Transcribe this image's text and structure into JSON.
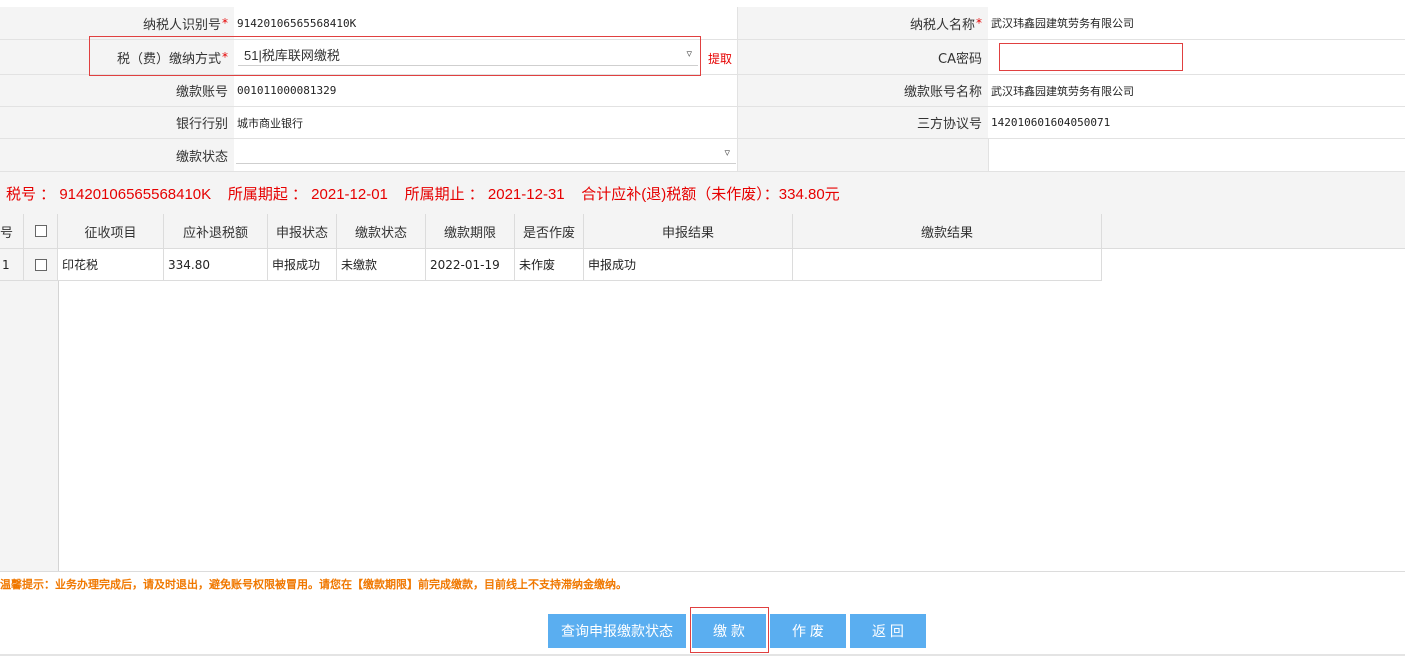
{
  "form": {
    "taxpayer_id_label": "纳税人识别号",
    "taxpayer_id_value": "91420106565568410K",
    "taxpayer_name_label": "纳税人名称",
    "taxpayer_name_value": "武汉玮鑫园建筑劳务有限公司",
    "payment_method_label": "税（费）缴纳方式",
    "payment_method_value": "51|税库联网缴税",
    "fetch_link": "提取",
    "ca_password_label": "CA密码",
    "ca_password_value": "",
    "account_no_label": "缴款账号",
    "account_no_value": "001011000081329",
    "account_name_label": "缴款账号名称",
    "account_name_value": "武汉玮鑫园建筑劳务有限公司",
    "bank_label": "银行行别",
    "bank_value": "城市商业银行",
    "agreement_label": "三方协议号",
    "agreement_value": "142010601604050071",
    "payment_status_label": "缴款状态",
    "payment_status_value": "",
    "required_mark": "*"
  },
  "summary": {
    "text": "税号 ： 91420106565568410K    所属期起 ： 2021-12-01    所属期止 ： 2021-12-31    合计应补(退)税额（未作废）：334.80元"
  },
  "table": {
    "headers": [
      "号",
      "",
      "征收项目",
      "应补退税额",
      "申报状态",
      "缴款状态",
      "缴款期限",
      "是否作废",
      "申报结果",
      "缴款结果"
    ],
    "rows": [
      {
        "index": "1",
        "item": "印花税",
        "amount": "334.80",
        "declare_status": "申报成功",
        "pay_status": "未缴款",
        "deadline": "2022-01-19",
        "voided": "未作废",
        "declare_result": "申报成功",
        "pay_result": ""
      }
    ]
  },
  "tip": "温馨提示：业务办理完成后，请及时退出，避免账号权限被冒用。请您在【缴款期限】前完成缴款，目前线上不支持滞纳金缴纳。",
  "buttons": {
    "query": "查询申报缴款状态",
    "pay": "缴 款",
    "void": "作 废",
    "back": "返 回"
  },
  "icons": {
    "dropdown": "chevron-down-icon"
  },
  "colors": {
    "accent_red": "#e60000",
    "button_blue": "#5aaef0",
    "tip_orange": "#f07800"
  }
}
